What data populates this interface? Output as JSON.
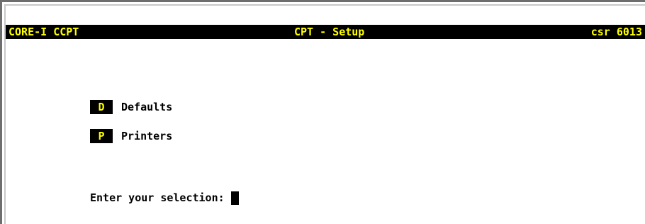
{
  "header": {
    "left": "CORE-I CCPT",
    "center": "CPT - Setup",
    "right": "csr 6013"
  },
  "menu": {
    "items": [
      {
        "key": "D",
        "label": "Defaults"
      },
      {
        "key": "P",
        "label": "Printers"
      }
    ]
  },
  "prompt": {
    "text": "Enter your selection:",
    "value": ""
  },
  "colors": {
    "bar_bg": "#000000",
    "bar_fg": "#ffff00",
    "text": "#000000",
    "background": "#ffffff"
  }
}
